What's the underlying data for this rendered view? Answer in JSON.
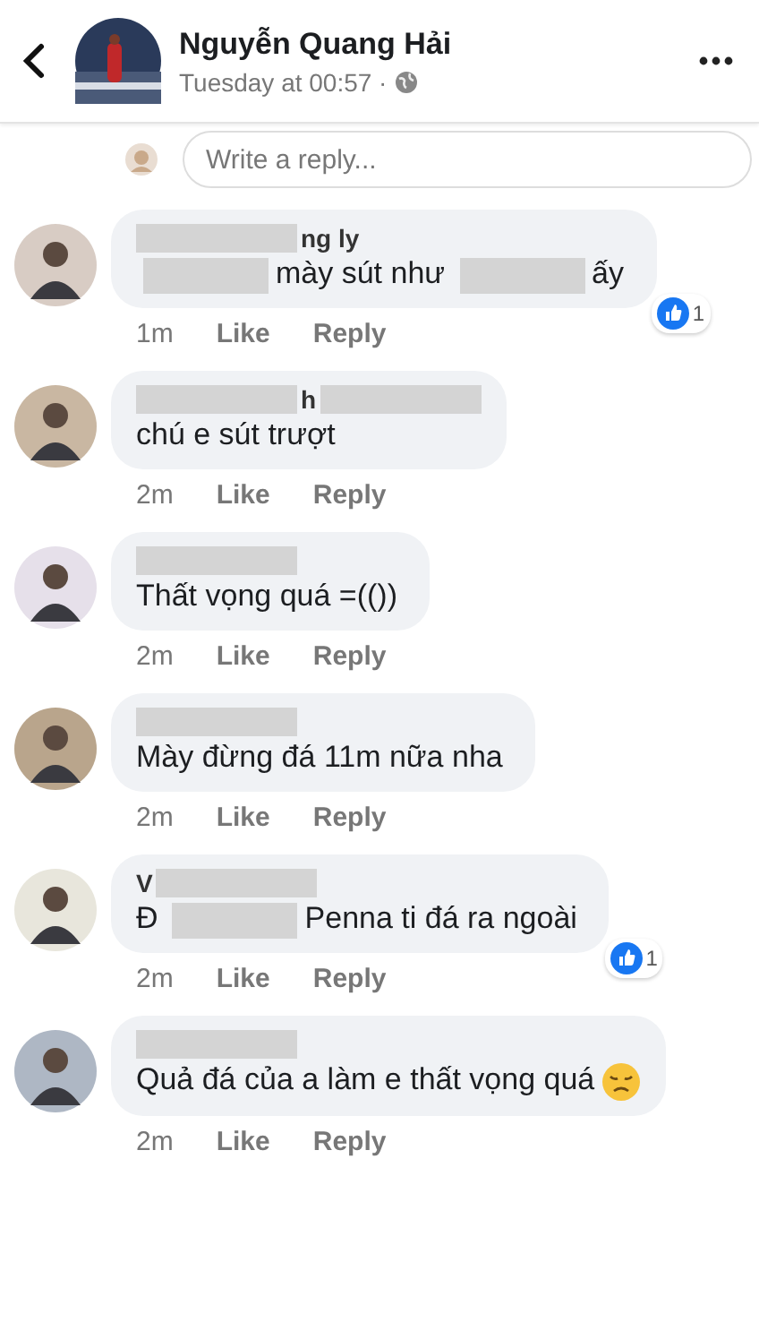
{
  "header": {
    "name": "Nguyễn Quang Hải",
    "time": "Tuesday at 00:57 ·"
  },
  "reply_field": {
    "placeholder": "Write a reply..."
  },
  "comments": [
    {
      "name": [
        {
          "kind": "redaction"
        },
        {
          "kind": "text",
          "text": "ng ly"
        }
      ],
      "body": [
        {
          "kind": "redaction"
        },
        {
          "kind": "text",
          "text": "mày sút như"
        },
        {
          "kind": "redaction"
        },
        {
          "kind": "text",
          "text": "ấy"
        }
      ],
      "time": "1m",
      "like": "Like",
      "reply": "Reply",
      "likes": "1"
    },
    {
      "name": [
        {
          "kind": "redaction"
        },
        {
          "kind": "text",
          "text": "h"
        },
        {
          "kind": "redaction"
        }
      ],
      "body": [
        {
          "kind": "text",
          "text": "chú e sút trượt"
        }
      ],
      "time": "2m",
      "like": "Like",
      "reply": "Reply"
    },
    {
      "name": [
        {
          "kind": "redaction"
        }
      ],
      "body": [
        {
          "kind": "text",
          "text": "Thất vọng quá =(())"
        }
      ],
      "time": "2m",
      "like": "Like",
      "reply": "Reply"
    },
    {
      "name": [
        {
          "kind": "redaction"
        }
      ],
      "body": [
        {
          "kind": "text",
          "text": "Mày đừng đá 11m nữa nha"
        }
      ],
      "time": "2m",
      "like": "Like",
      "reply": "Reply"
    },
    {
      "name": [
        {
          "kind": "text",
          "text": "V"
        },
        {
          "kind": "redaction"
        }
      ],
      "body": [
        {
          "kind": "text",
          "text": "Đ"
        },
        {
          "kind": "redaction"
        },
        {
          "kind": "text",
          "text": "Penna ti đá ra ngoài"
        }
      ],
      "time": "2m",
      "like": "Like",
      "reply": "Reply",
      "likes": "1"
    },
    {
      "name": [
        {
          "kind": "redaction"
        }
      ],
      "body": [
        {
          "kind": "text",
          "text": "Quả đá của a làm e thất vọng quá"
        },
        {
          "kind": "emoji"
        }
      ],
      "time": "2m",
      "like": "Like",
      "reply": "Reply"
    }
  ]
}
